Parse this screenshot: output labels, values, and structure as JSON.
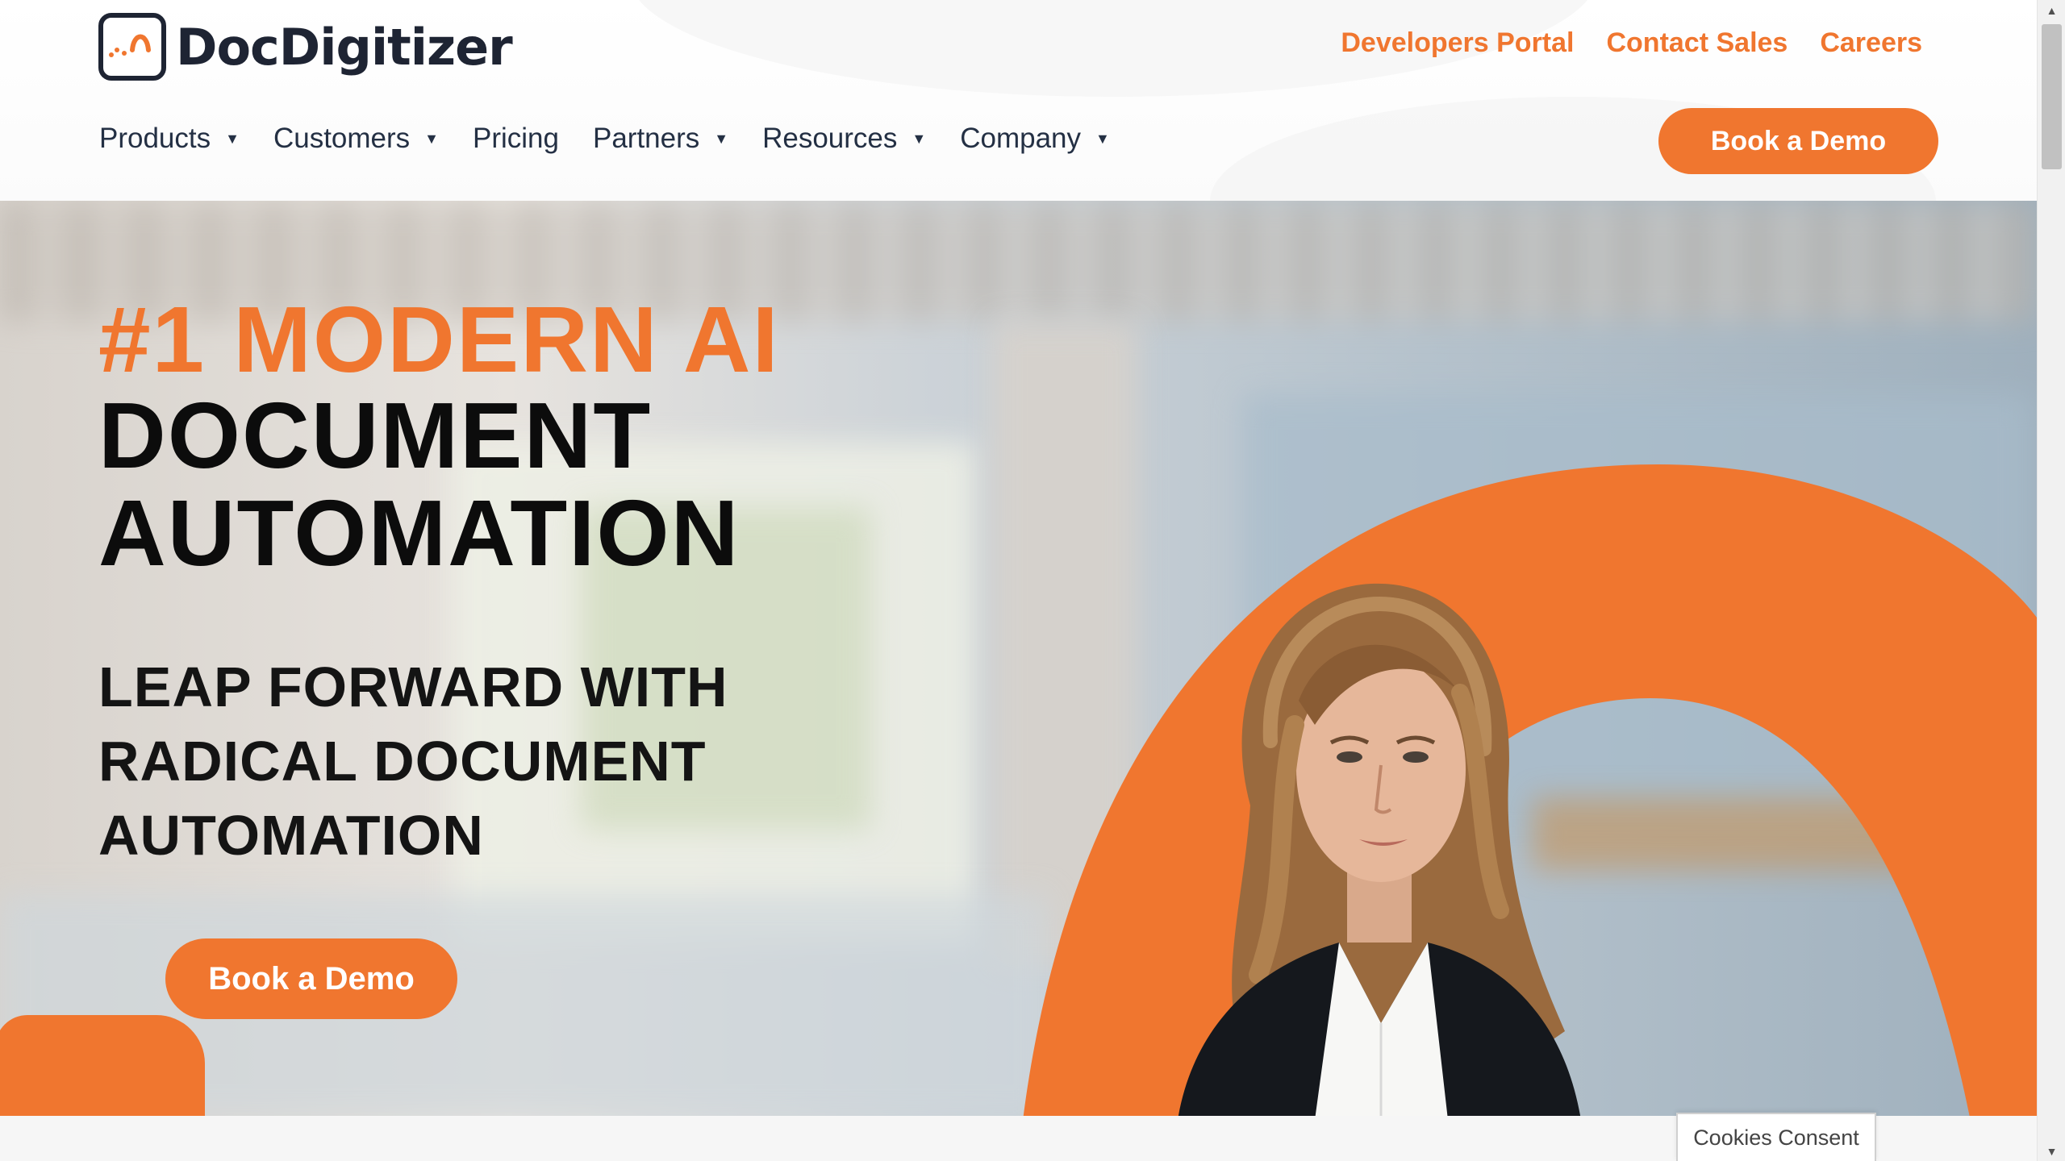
{
  "brand": {
    "name": "DocDigitizer",
    "logo_icon": "docdigitizer-logo-icon",
    "accent_color": "#f0762f",
    "text_color": "#1e2433"
  },
  "top_links": [
    {
      "label": "Developers Portal"
    },
    {
      "label": "Contact Sales"
    },
    {
      "label": "Careers"
    }
  ],
  "nav": {
    "items": [
      {
        "label": "Products",
        "has_dropdown": true
      },
      {
        "label": "Customers",
        "has_dropdown": true
      },
      {
        "label": "Pricing",
        "has_dropdown": false
      },
      {
        "label": "Partners",
        "has_dropdown": true
      },
      {
        "label": "Resources",
        "has_dropdown": true
      },
      {
        "label": "Company",
        "has_dropdown": true
      }
    ],
    "cta_label": "Book a Demo"
  },
  "hero": {
    "title_line_1": "#1 MODERN AI",
    "title_line_2": "DOCUMENT",
    "title_line_3": "AUTOMATION",
    "subtitle_line_1": "LEAP FORWARD WITH",
    "subtitle_line_2": "RADICAL DOCUMENT",
    "subtitle_line_3": "AUTOMATION",
    "cta_label": "Book a Demo"
  },
  "cookies": {
    "label": "Cookies Consent"
  }
}
